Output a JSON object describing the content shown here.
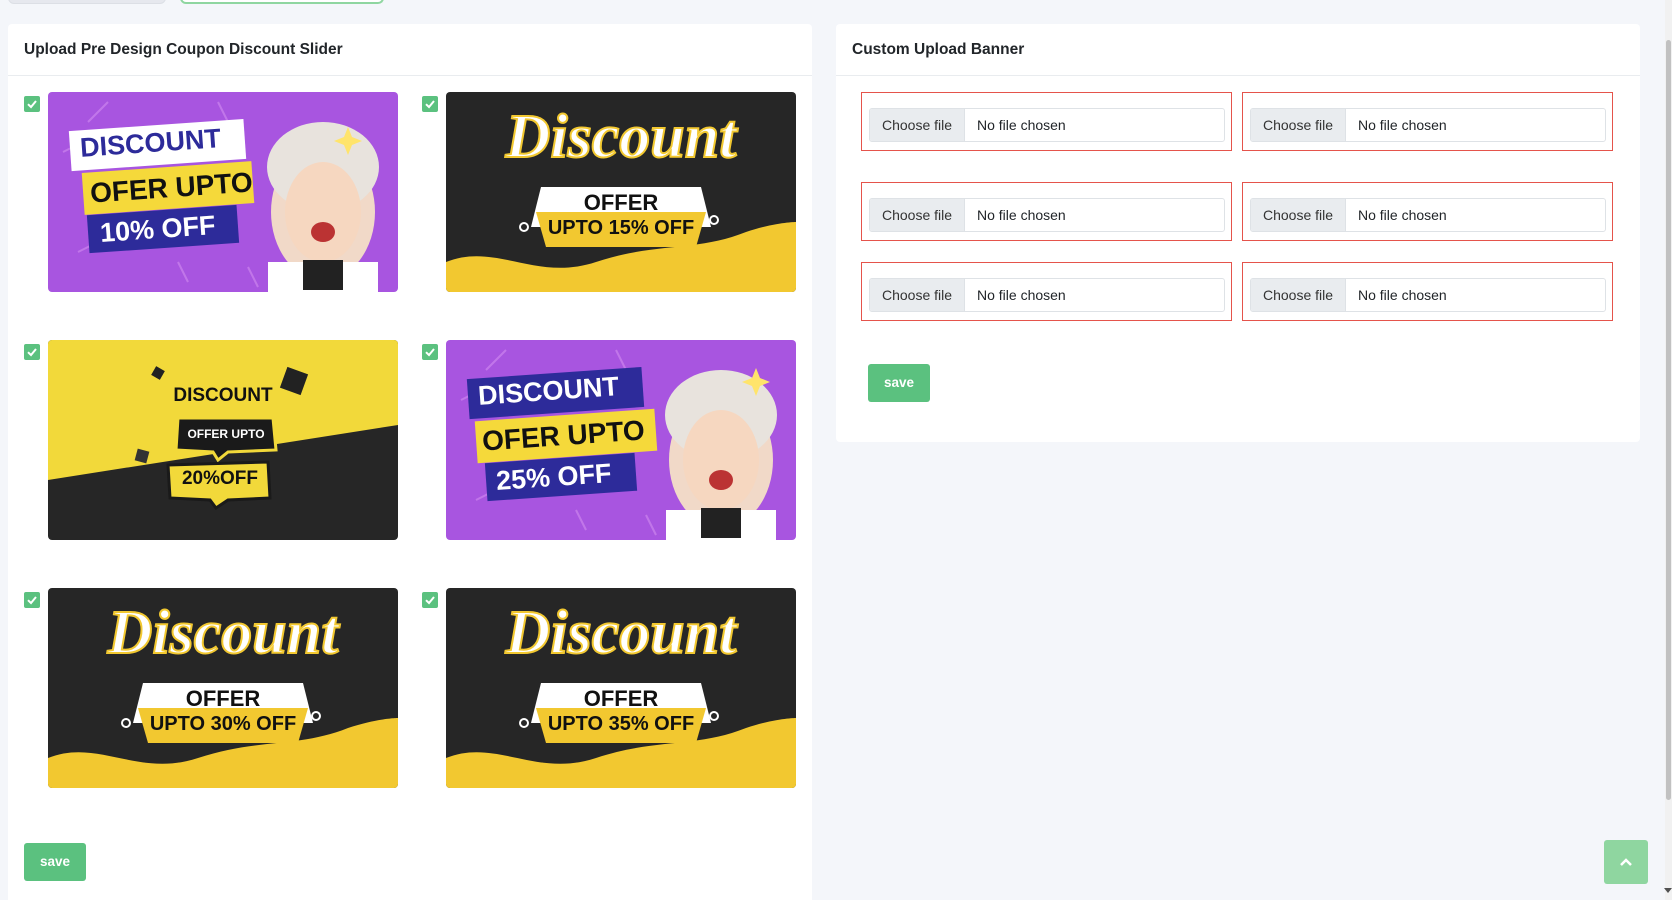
{
  "left_panel": {
    "title": "Upload Pre Design Coupon Discount Slider",
    "save_label": "save",
    "banners": [
      {
        "style": "purple",
        "line1": "DISCOUNT",
        "line2": "OFER UPTO",
        "line3": "10% OFF",
        "checked": true
      },
      {
        "style": "dark",
        "line1": "Discount",
        "line2": "OFFER",
        "line3": "UPTO 15% OFF",
        "checked": true
      },
      {
        "style": "yellow",
        "line1": "DISCOUNT",
        "line2": "OFFER UPTO",
        "line3": "20%OFF",
        "checked": true
      },
      {
        "style": "purple",
        "line1": "DISCOUNT",
        "line2": "OFER UPTO",
        "line3": "25% OFF",
        "checked": true
      },
      {
        "style": "dark",
        "line1": "Discount",
        "line2": "OFFER",
        "line3": "UPTO 30% OFF",
        "checked": true
      },
      {
        "style": "dark",
        "line1": "Discount",
        "line2": "OFFER",
        "line3": "UPTO 35% OFF",
        "checked": true
      }
    ]
  },
  "right_panel": {
    "title": "Custom Upload Banner",
    "save_label": "save",
    "file_inputs": [
      {
        "button": "Choose file",
        "status": "No file chosen"
      },
      {
        "button": "Choose file",
        "status": "No file chosen"
      },
      {
        "button": "Choose file",
        "status": "No file chosen"
      },
      {
        "button": "Choose file",
        "status": "No file chosen"
      },
      {
        "button": "Choose file",
        "status": "No file chosen"
      },
      {
        "button": "Choose file",
        "status": "No file chosen"
      }
    ]
  },
  "colors": {
    "success": "#5bc17f",
    "error_border": "#e5534b",
    "purple": "#a855e0",
    "yellow": "#f2c830",
    "dark": "#262626"
  },
  "icons": [
    "check-icon",
    "chevron-up-icon",
    "sparkle-icon"
  ]
}
